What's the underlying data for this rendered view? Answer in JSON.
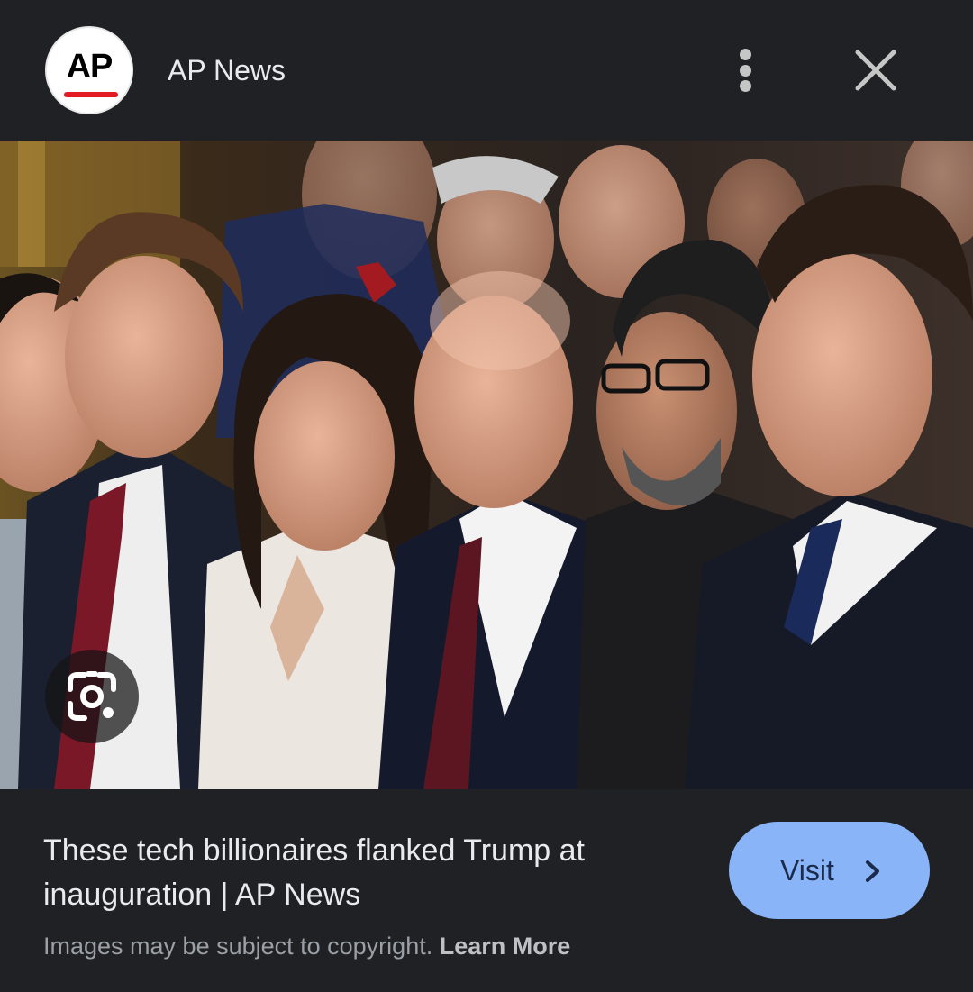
{
  "header": {
    "logo_text": "AP",
    "source_name": "AP News",
    "more_icon": "more-vert-icon",
    "close_icon": "close-icon"
  },
  "image": {
    "lens_icon": "google-lens-icon"
  },
  "result": {
    "title": "These tech billionaires flanked Trump at inauguration | AP News",
    "visit_label": "Visit",
    "visit_icon": "chevron-right-icon",
    "copyright_text": "Images may be subject to copyright.",
    "learn_more_label": "Learn More"
  },
  "colors": {
    "background": "#202124",
    "visit_button": "#8ab4f8",
    "logo_red": "#e31b23",
    "text_primary": "#e8eaed",
    "text_secondary": "#9aa0a6"
  }
}
